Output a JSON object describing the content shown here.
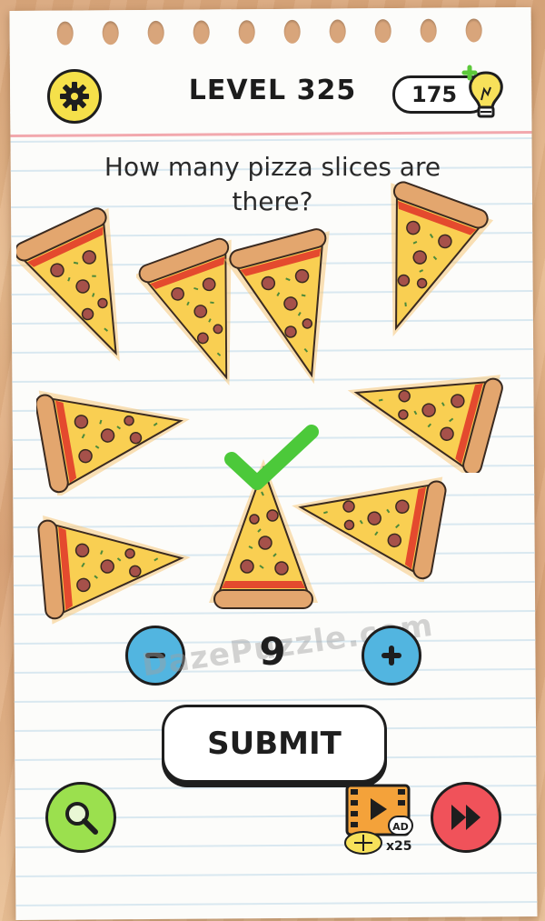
{
  "header": {
    "level_title": "LEVEL 325",
    "hint_count": "175"
  },
  "question": {
    "line1": "How many pizza slices are",
    "line2": "there?"
  },
  "answer": {
    "value": "9"
  },
  "submit_label": "SUBMIT",
  "watermark": "DazePuzzle.com",
  "ad_reward": "x25",
  "ad_badge": "AD",
  "icons": {
    "settings": "gear-icon",
    "hints": "lightbulb-plus-icon",
    "minus": "minus-icon",
    "plus": "plus-icon",
    "search": "magnifier-icon",
    "video": "film-ad-icon",
    "skip": "fast-forward-icon",
    "check": "checkmark-icon"
  },
  "colors": {
    "settings_bg": "#f5e04a",
    "stepper_bg": "#52b5e0",
    "search_bg": "#9be04e",
    "skip_bg": "#f0525a",
    "check": "#4cc93a"
  }
}
